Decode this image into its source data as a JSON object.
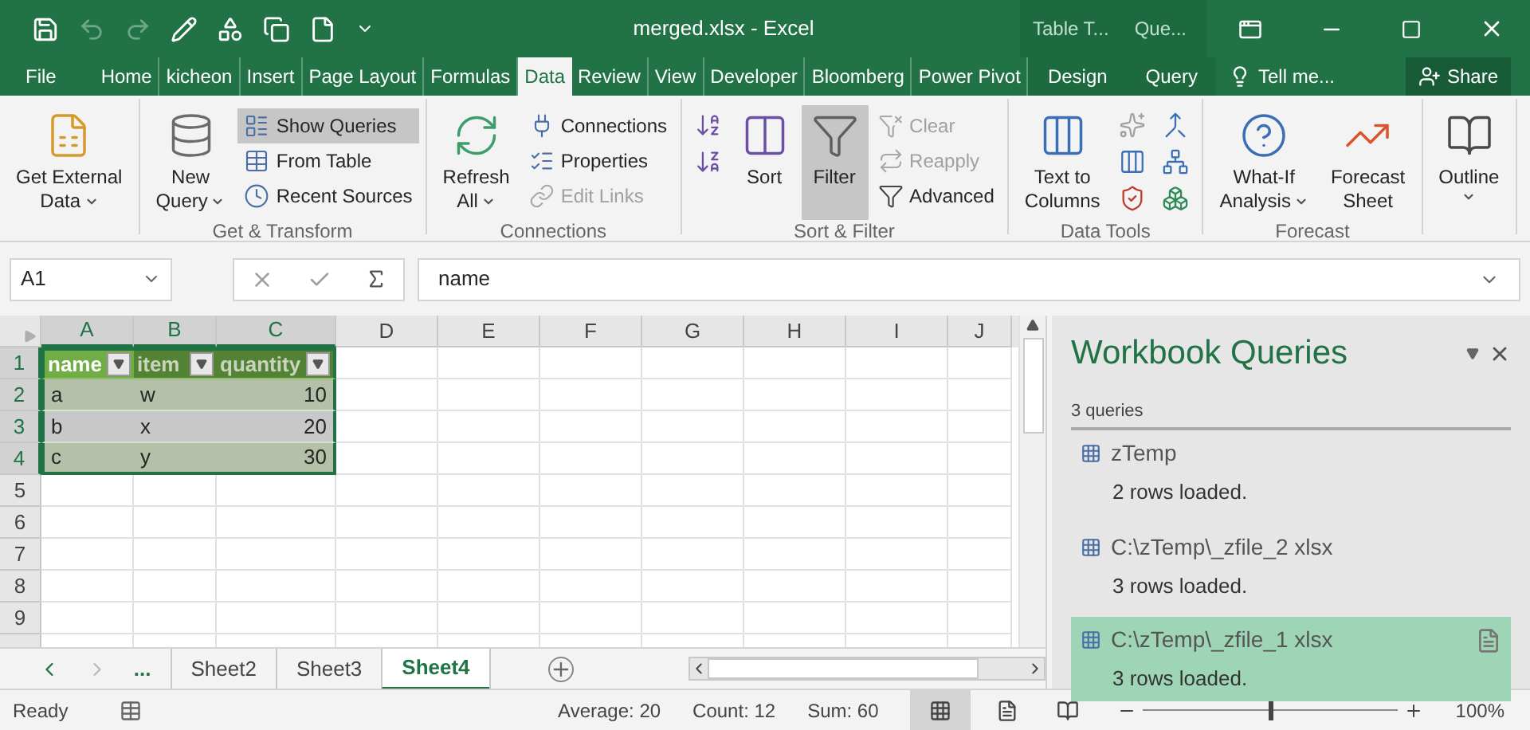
{
  "title_bar": {
    "title": "merged.xlsx - Excel",
    "context_groups": [
      "Table T...",
      "Que..."
    ]
  },
  "tabs": [
    {
      "label": "File",
      "selected": false,
      "kind": "file"
    },
    {
      "label": "Home",
      "selected": false,
      "kind": "normal"
    },
    {
      "label": "kicheon",
      "selected": false,
      "kind": "normal"
    },
    {
      "label": "Insert",
      "selected": false,
      "kind": "normal"
    },
    {
      "label": "Page Layout",
      "selected": false,
      "kind": "normal"
    },
    {
      "label": "Formulas",
      "selected": false,
      "kind": "normal"
    },
    {
      "label": "Data",
      "selected": true,
      "kind": "normal"
    },
    {
      "label": "Review",
      "selected": false,
      "kind": "normal"
    },
    {
      "label": "View",
      "selected": false,
      "kind": "normal"
    },
    {
      "label": "Developer",
      "selected": false,
      "kind": "normal"
    },
    {
      "label": "Bloomberg",
      "selected": false,
      "kind": "normal"
    },
    {
      "label": "Power Pivot",
      "selected": false,
      "kind": "normal"
    },
    {
      "label": "Design",
      "selected": false,
      "kind": "contextual"
    },
    {
      "label": "Query",
      "selected": false,
      "kind": "contextual"
    }
  ],
  "tell_me": "Tell me...",
  "share": "Share",
  "ribbon": [
    {
      "commands": [
        {
          "kind": "large",
          "lines": [
            "Get External",
            "Data"
          ],
          "dropdown": true,
          "disabled": false,
          "selected": false
        }
      ]
    },
    {
      "label": "Get & Transform",
      "commands": [
        {
          "kind": "large",
          "lines": [
            "New",
            "Query"
          ],
          "dropdown": true,
          "disabled": false,
          "selected": false
        },
        {
          "kind": "small",
          "lines": [
            "Show Queries"
          ],
          "disabled": false,
          "selected": true
        },
        {
          "kind": "small",
          "lines": [
            "From Table"
          ],
          "disabled": false,
          "selected": false
        },
        {
          "kind": "small",
          "lines": [
            "Recent Sources"
          ],
          "disabled": false,
          "selected": false
        }
      ]
    },
    {
      "label": "Connections",
      "commands": [
        {
          "kind": "large",
          "lines": [
            "Refresh",
            "All"
          ],
          "dropdown": true,
          "disabled": false,
          "selected": false
        },
        {
          "kind": "small",
          "lines": [
            "Connections"
          ],
          "disabled": false,
          "selected": false
        },
        {
          "kind": "small",
          "lines": [
            "Properties"
          ],
          "disabled": false,
          "selected": false
        },
        {
          "kind": "small",
          "lines": [
            "Edit Links"
          ],
          "disabled": true,
          "selected": false
        }
      ]
    },
    {
      "label": "Sort & Filter",
      "commands": [
        {
          "kind": "large",
          "lines": [
            "Sort"
          ],
          "dropdown": false,
          "disabled": false,
          "selected": false
        },
        {
          "kind": "large",
          "lines": [
            "Filter"
          ],
          "dropdown": false,
          "disabled": false,
          "selected": true
        },
        {
          "kind": "small",
          "lines": [
            "Clear"
          ],
          "disabled": true,
          "selected": false
        },
        {
          "kind": "small",
          "lines": [
            "Reapply"
          ],
          "disabled": true,
          "selected": false
        },
        {
          "kind": "small",
          "lines": [
            "Advanced"
          ],
          "disabled": false,
          "selected": false
        }
      ]
    },
    {
      "label": "Data Tools",
      "commands": [
        {
          "kind": "large",
          "lines": [
            "Text to",
            "Columns"
          ],
          "dropdown": false,
          "disabled": false,
          "selected": false
        }
      ]
    },
    {
      "label": "Forecast",
      "commands": [
        {
          "kind": "large",
          "lines": [
            "What-If",
            "Analysis"
          ],
          "dropdown": true,
          "disabled": false,
          "selected": false
        },
        {
          "kind": "large",
          "lines": [
            "Forecast",
            "Sheet"
          ],
          "dropdown": false,
          "disabled": false,
          "selected": false
        }
      ]
    },
    {
      "commands": [
        {
          "kind": "large",
          "lines": [
            "Outline"
          ],
          "dropdown": true,
          "disabled": false,
          "selected": false
        }
      ]
    }
  ],
  "name_box": "A1",
  "formula": "name",
  "columns": [
    {
      "label": "A",
      "selected": true
    },
    {
      "label": "B",
      "selected": true
    },
    {
      "label": "C",
      "selected": true
    },
    {
      "label": "D",
      "selected": false
    },
    {
      "label": "E",
      "selected": false
    },
    {
      "label": "F",
      "selected": false
    },
    {
      "label": "G",
      "selected": false
    },
    {
      "label": "H",
      "selected": false
    },
    {
      "label": "I",
      "selected": false
    },
    {
      "label": "J",
      "selected": false
    }
  ],
  "row_headers": [
    {
      "label": "1",
      "selected": true
    },
    {
      "label": "2",
      "selected": true
    },
    {
      "label": "3",
      "selected": true
    },
    {
      "label": "4",
      "selected": true
    },
    {
      "label": "5",
      "selected": false
    },
    {
      "label": "6",
      "selected": false
    },
    {
      "label": "7",
      "selected": false
    },
    {
      "label": "8",
      "selected": false
    },
    {
      "label": "9",
      "selected": false
    }
  ],
  "table": {
    "headers": [
      {
        "label": "name",
        "selected": true,
        "numeric": false
      },
      {
        "label": "item",
        "selected": false,
        "numeric": false
      },
      {
        "label": "quantity",
        "selected": false,
        "numeric": true
      }
    ],
    "rows": [
      [
        "a",
        "w",
        "10"
      ],
      [
        "b",
        "x",
        "20"
      ],
      [
        "c",
        "y",
        "30"
      ]
    ]
  },
  "sheet_tabs": {
    "more": "...",
    "tabs": [
      {
        "label": "Sheet2",
        "selected": false
      },
      {
        "label": "Sheet3",
        "selected": false
      },
      {
        "label": "Sheet4",
        "selected": true
      }
    ]
  },
  "queries_pane": {
    "title": "Workbook Queries",
    "count": "3 queries",
    "queries": [
      {
        "name": "zTemp",
        "status": "2 rows loaded.",
        "selected": false
      },
      {
        "name": "C:\\zTemp\\_zfile_2 xlsx",
        "status": "3 rows loaded.",
        "selected": false
      },
      {
        "name": "C:\\zTemp\\_zfile_1 xlsx",
        "status": "3 rows loaded.",
        "selected": true
      }
    ]
  },
  "status_bar": {
    "ready": "Ready",
    "average": "Average: 20",
    "count": "Count: 12",
    "sum": "Sum: 60",
    "zoom": "100%",
    "zoom_level": {
      "level": 0.5
    }
  }
}
